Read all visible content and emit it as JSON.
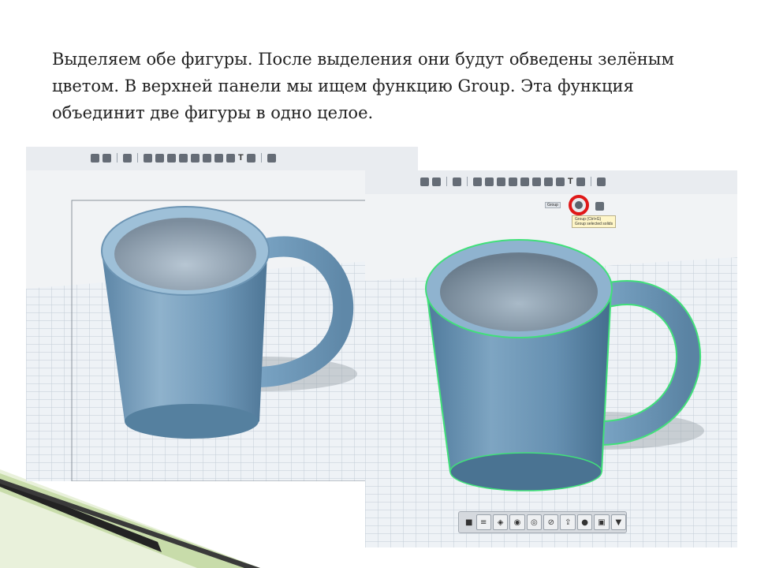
{
  "caption": {
    "line1": "Выделяем обе фигуры. После выделения они будут обведены зелёным",
    "line2": "цветом. В верхней панели мы ищем функцию Group. Эта функция",
    "line3": "объединит две фигуры в одно целое."
  },
  "toolbar": {
    "text_tool_glyph": "T"
  },
  "group_label": "Group",
  "tooltip": {
    "line1": "Group (Ctrl+G)",
    "line2": "Group selected solids"
  },
  "bottom_toolbar": {
    "icons": [
      "cube-icon",
      "filter-icon",
      "layers-icon",
      "tag-icon",
      "eye-icon",
      "eye-off-icon",
      "export-icon",
      "material-icon",
      "render-icon",
      "arrow-icon"
    ],
    "glyphs": [
      "■",
      "≡",
      "◈",
      "◉",
      "◎",
      "⊘",
      "⇪",
      "●",
      "▣",
      "▼"
    ]
  },
  "colors": {
    "mug": "#6f97b6",
    "selection": "#41e07a",
    "highlight_ring": "#e01818",
    "grid_bg": "#ecf1f5"
  }
}
